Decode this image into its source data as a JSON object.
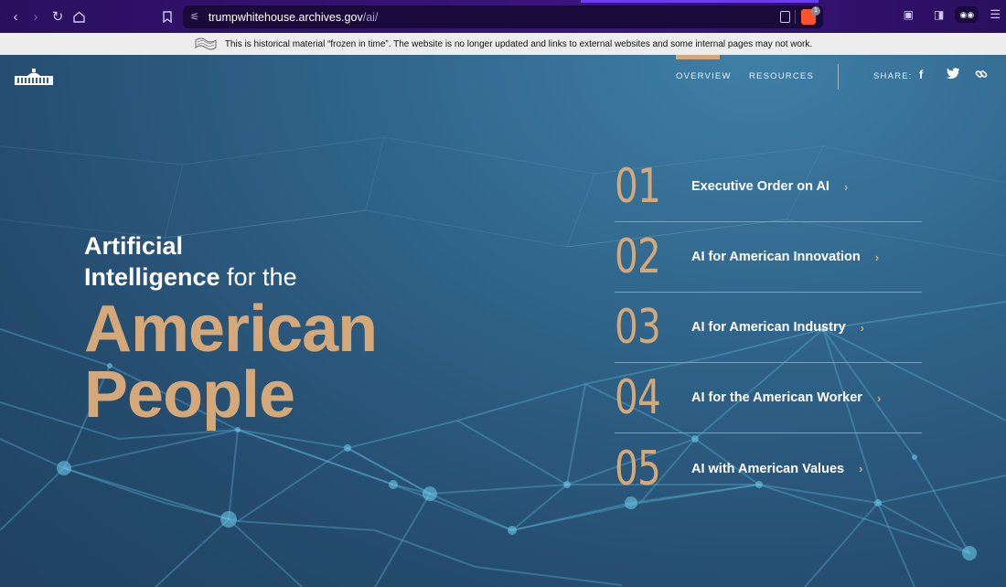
{
  "browser": {
    "url_domain": "trumpwhitehouse.archives.gov",
    "url_path": "/ai/"
  },
  "banner": {
    "text": "This is historical material “frozen in time”. The website is no longer updated and links to external websites and some internal pages may not work."
  },
  "nav": {
    "overview": "OVERVIEW",
    "resources": "RESOURCES",
    "share": "SHARE:"
  },
  "headline": {
    "line1": "Artificial",
    "line2_bold": "Intelligence",
    "line2_light": " for the",
    "line3": "American",
    "line4": "People"
  },
  "items": [
    {
      "num": "01",
      "title": "Executive Order on AI"
    },
    {
      "num": "02",
      "title": "AI for American Innovation"
    },
    {
      "num": "03",
      "title": "AI for American Industry"
    },
    {
      "num": "04",
      "title": "AI for the American Worker"
    },
    {
      "num": "05",
      "title": "AI with American Values"
    }
  ],
  "colors": {
    "gold": "#d4a878",
    "chrome": "#2a0f5e"
  }
}
